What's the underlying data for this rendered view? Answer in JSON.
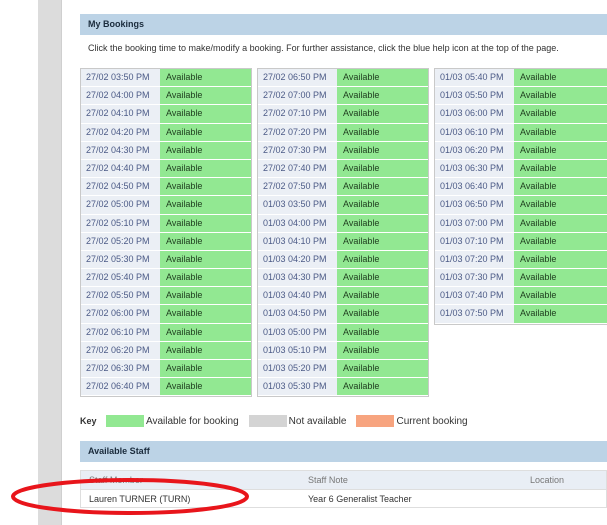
{
  "bookings": {
    "title": "My Bookings",
    "instruction": "Click the booking time to make/modify a booking. For further assistance, click the blue help icon at the top of the page.",
    "columns": [
      [
        {
          "time": "27/02 03:50 PM",
          "status": "Available"
        },
        {
          "time": "27/02 04:00 PM",
          "status": "Available"
        },
        {
          "time": "27/02 04:10 PM",
          "status": "Available"
        },
        {
          "time": "27/02 04:20 PM",
          "status": "Available"
        },
        {
          "time": "27/02 04:30 PM",
          "status": "Available"
        },
        {
          "time": "27/02 04:40 PM",
          "status": "Available"
        },
        {
          "time": "27/02 04:50 PM",
          "status": "Available"
        },
        {
          "time": "27/02 05:00 PM",
          "status": "Available"
        },
        {
          "time": "27/02 05:10 PM",
          "status": "Available"
        },
        {
          "time": "27/02 05:20 PM",
          "status": "Available"
        },
        {
          "time": "27/02 05:30 PM",
          "status": "Available"
        },
        {
          "time": "27/02 05:40 PM",
          "status": "Available"
        },
        {
          "time": "27/02 05:50 PM",
          "status": "Available"
        },
        {
          "time": "27/02 06:00 PM",
          "status": "Available"
        },
        {
          "time": "27/02 06:10 PM",
          "status": "Available"
        },
        {
          "time": "27/02 06:20 PM",
          "status": "Available"
        },
        {
          "time": "27/02 06:30 PM",
          "status": "Available"
        },
        {
          "time": "27/02 06:40 PM",
          "status": "Available"
        }
      ],
      [
        {
          "time": "27/02 06:50 PM",
          "status": "Available"
        },
        {
          "time": "27/02 07:00 PM",
          "status": "Available"
        },
        {
          "time": "27/02 07:10 PM",
          "status": "Available"
        },
        {
          "time": "27/02 07:20 PM",
          "status": "Available"
        },
        {
          "time": "27/02 07:30 PM",
          "status": "Available"
        },
        {
          "time": "27/02 07:40 PM",
          "status": "Available"
        },
        {
          "time": "27/02 07:50 PM",
          "status": "Available"
        },
        {
          "time": "01/03 03:50 PM",
          "status": "Available"
        },
        {
          "time": "01/03 04:00 PM",
          "status": "Available"
        },
        {
          "time": "01/03 04:10 PM",
          "status": "Available"
        },
        {
          "time": "01/03 04:20 PM",
          "status": "Available"
        },
        {
          "time": "01/03 04:30 PM",
          "status": "Available"
        },
        {
          "time": "01/03 04:40 PM",
          "status": "Available"
        },
        {
          "time": "01/03 04:50 PM",
          "status": "Available"
        },
        {
          "time": "01/03 05:00 PM",
          "status": "Available"
        },
        {
          "time": "01/03 05:10 PM",
          "status": "Available"
        },
        {
          "time": "01/03 05:20 PM",
          "status": "Available"
        },
        {
          "time": "01/03 05:30 PM",
          "status": "Available"
        }
      ],
      [
        {
          "time": "01/03 05:40 PM",
          "status": "Available"
        },
        {
          "time": "01/03 05:50 PM",
          "status": "Available"
        },
        {
          "time": "01/03 06:00 PM",
          "status": "Available"
        },
        {
          "time": "01/03 06:10 PM",
          "status": "Available"
        },
        {
          "time": "01/03 06:20 PM",
          "status": "Available"
        },
        {
          "time": "01/03 06:30 PM",
          "status": "Available"
        },
        {
          "time": "01/03 06:40 PM",
          "status": "Available"
        },
        {
          "time": "01/03 06:50 PM",
          "status": "Available"
        },
        {
          "time": "01/03 07:00 PM",
          "status": "Available"
        },
        {
          "time": "01/03 07:10 PM",
          "status": "Available"
        },
        {
          "time": "01/03 07:20 PM",
          "status": "Available"
        },
        {
          "time": "01/03 07:30 PM",
          "status": "Available"
        },
        {
          "time": "01/03 07:40 PM",
          "status": "Available"
        },
        {
          "time": "01/03 07:50 PM",
          "status": "Available"
        }
      ]
    ]
  },
  "key": {
    "title": "Key",
    "items": [
      {
        "label": "Available for booking",
        "color": "#92e892"
      },
      {
        "label": "Not available",
        "color": "#d4d4d4"
      },
      {
        "label": "Current booking",
        "color": "#f7a47f"
      }
    ]
  },
  "staff": {
    "title": "Available Staff",
    "headers": {
      "member": "Staff Member",
      "note": "Staff Note",
      "location": "Location"
    },
    "rows": [
      {
        "member": "Lauren TURNER (TURN)",
        "note": "Year 6 Generalist Teacher",
        "location": ""
      }
    ]
  },
  "colors": {
    "header_bg": "#bcd3e6",
    "time_bg": "#ebeff5",
    "available": "#92e892",
    "annotation": "#e8151b"
  }
}
